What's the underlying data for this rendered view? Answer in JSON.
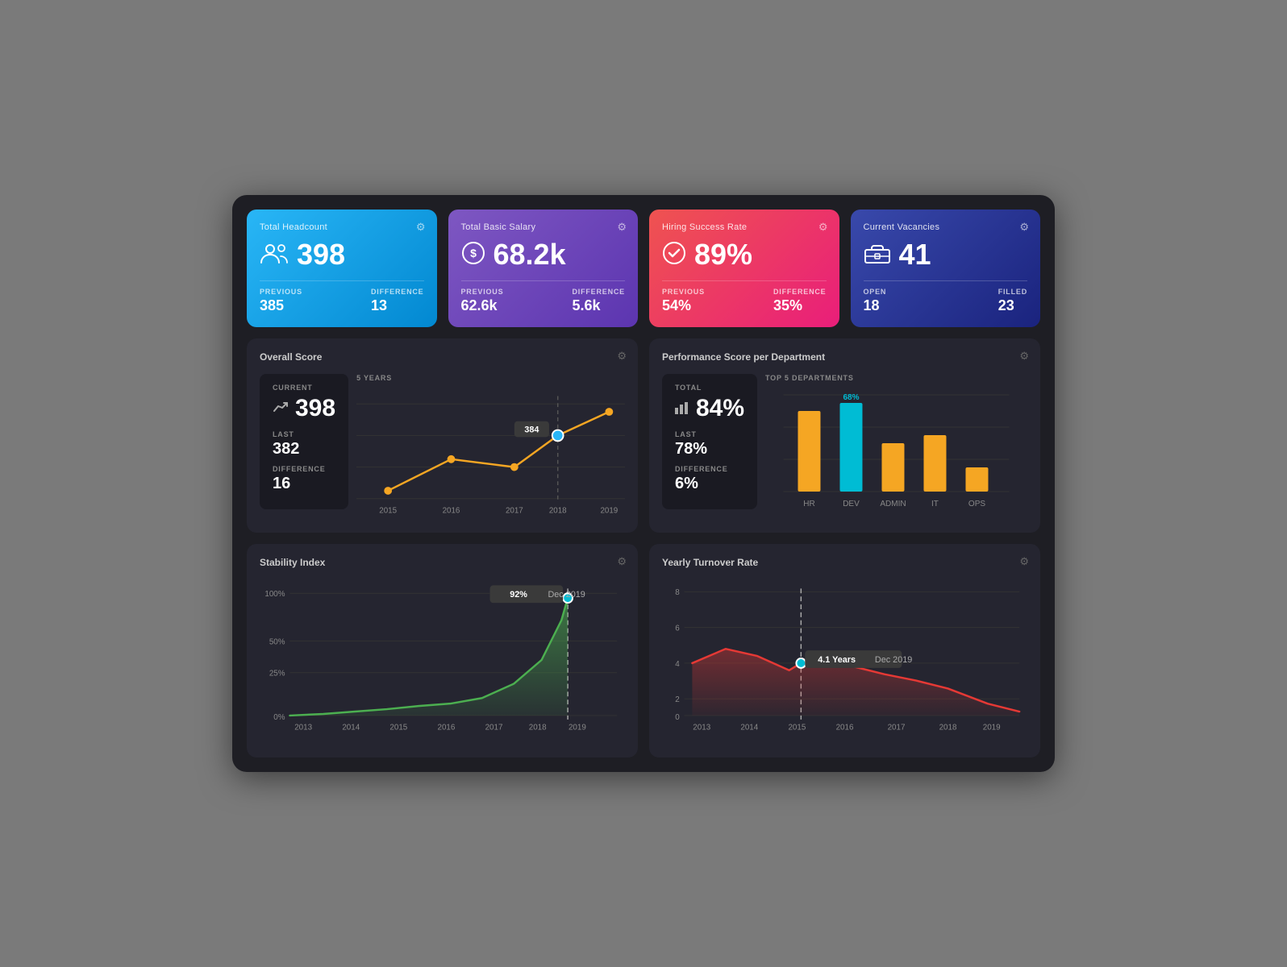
{
  "kpi_cards": [
    {
      "id": "total-headcount",
      "title": "Total Headcount",
      "color": "blue",
      "icon": "👥",
      "value": "398",
      "footer_left_label": "PREVIOUS",
      "footer_left_value": "385",
      "footer_right_label": "DIFFERENCE",
      "footer_right_value": "13"
    },
    {
      "id": "total-basic-salary",
      "title": "Total Basic Salary",
      "color": "purple",
      "icon": "$",
      "value": "68.2k",
      "footer_left_label": "PREVIOUS",
      "footer_left_value": "62.6k",
      "footer_right_label": "DIFFERENCE",
      "footer_right_value": "5.6k"
    },
    {
      "id": "hiring-success-rate",
      "title": "Hiring Success Rate",
      "color": "pink",
      "icon": "✓",
      "value": "89%",
      "footer_left_label": "PREVIOUS",
      "footer_left_value": "54%",
      "footer_right_label": "DIFFERENCE",
      "footer_right_value": "35%"
    },
    {
      "id": "current-vacancies",
      "title": "Current Vacancies",
      "color": "navy",
      "icon": "💼",
      "value": "41",
      "footer_left_label": "OPEN",
      "footer_left_value": "18",
      "footer_right_label": "FILLED",
      "footer_right_value": "23"
    }
  ],
  "overall_score": {
    "title": "Overall Score",
    "current_label": "CURRENT",
    "current_value": "398",
    "last_label": "LAST",
    "last_value": "382",
    "diff_label": "DIFFERENCE",
    "diff_value": "16",
    "chart_title": "5 YEARS",
    "years": [
      "2015",
      "2016",
      "2017",
      "2018",
      "2019"
    ],
    "tooltip_value": "384",
    "tooltip_year": "2018"
  },
  "performance_score": {
    "title": "Performance Score per Department",
    "total_label": "TOTAL",
    "total_value": "84%",
    "last_label": "LAST",
    "last_value": "78%",
    "diff_label": "DIFFERENCE",
    "diff_value": "6%",
    "chart_title": "TOP 5 DEPARTMENTS",
    "departments": [
      "HR",
      "DEV",
      "ADMIN",
      "IT",
      "OPS"
    ],
    "dept_label": "68%",
    "dept_highlight": "DEV"
  },
  "stability_index": {
    "title": "Stability Index",
    "y_labels": [
      "100%",
      "50%",
      "25%",
      "0%"
    ],
    "x_labels": [
      "2013",
      "2014",
      "2015",
      "2016",
      "2017",
      "2018",
      "2019"
    ],
    "tooltip_value": "92%",
    "tooltip_date": "Dec 2019"
  },
  "yearly_turnover": {
    "title": "Yearly Turnover Rate",
    "y_labels": [
      "8",
      "6",
      "4",
      "2",
      "0"
    ],
    "x_labels": [
      "2013",
      "2014",
      "2015",
      "2016",
      "2017",
      "2018",
      "2019"
    ],
    "tooltip_value": "4.1 Years",
    "tooltip_date": "Dec 2019"
  },
  "gear_icon": "⚙",
  "colors": {
    "blue": "#29b6f6",
    "orange": "#f5a623",
    "cyan": "#00bcd4",
    "green": "#4caf50",
    "red": "#e53935",
    "purple": "#7e57c2",
    "pink": "#e91e7a"
  }
}
